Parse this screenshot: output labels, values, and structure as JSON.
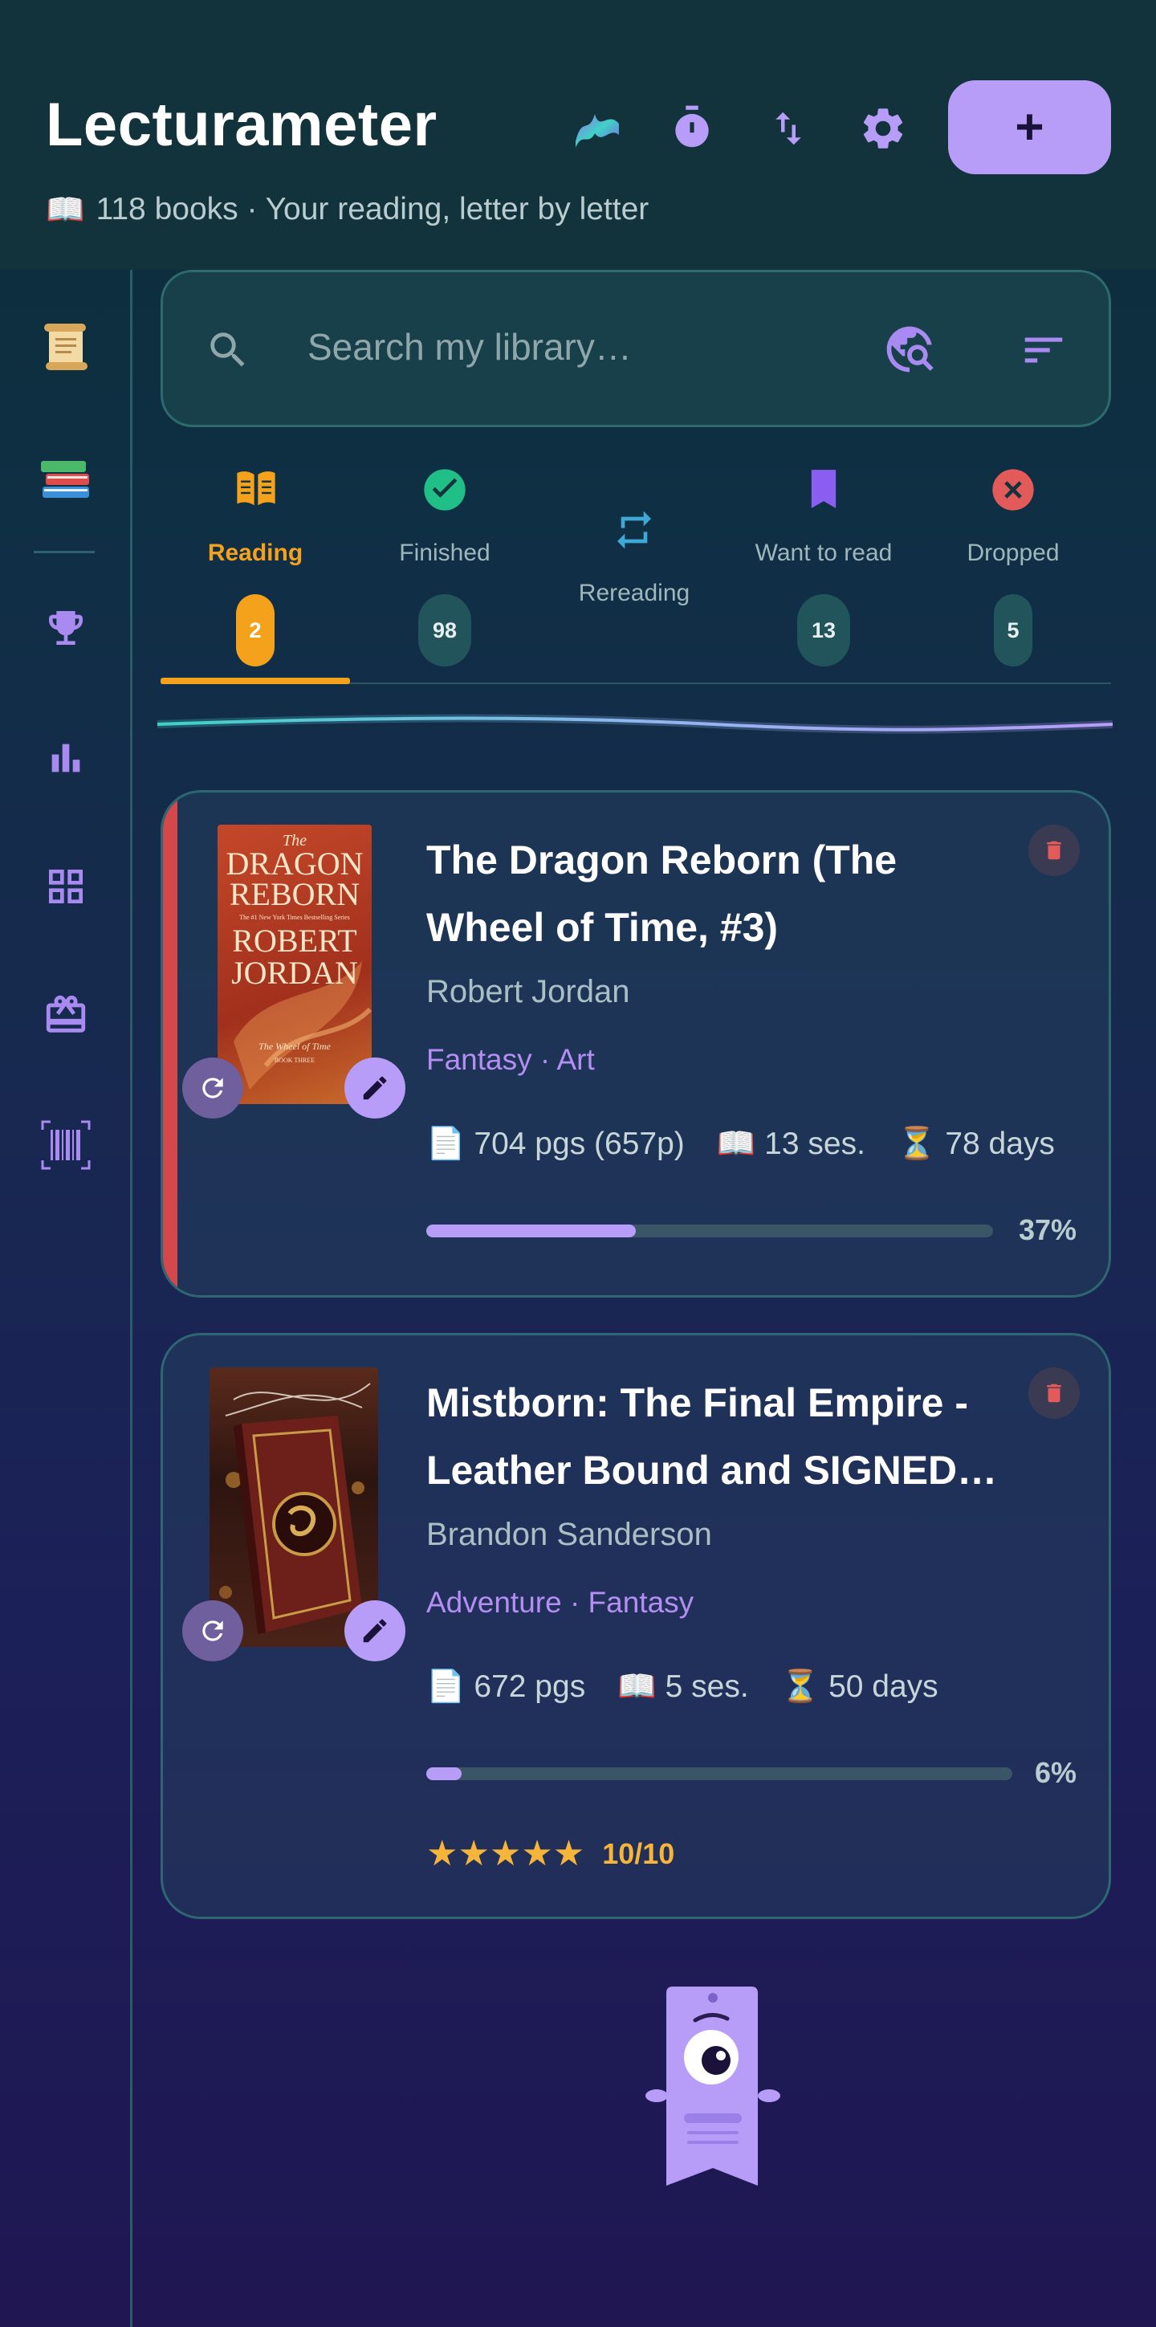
{
  "app": {
    "title": "Lecturameter",
    "subtitle_icon": "📖",
    "subtitle": "118 books · Your reading, letter by letter",
    "add_label": "+"
  },
  "header_icons": [
    "aurora-icon",
    "timer-icon",
    "swap-vertical-icon",
    "gear-icon"
  ],
  "sidebar": [
    "scroll-icon",
    "books-icon",
    "trophy-icon",
    "bar-chart-icon",
    "grid-icon",
    "gift-icon",
    "barcode-icon"
  ],
  "search": {
    "placeholder": "Search my library…"
  },
  "tabs": [
    {
      "label": "Reading",
      "count": "2"
    },
    {
      "label": "Finished",
      "count": "98"
    },
    {
      "label": "Rereading",
      "count": ""
    },
    {
      "label": "Want to read",
      "count": "13"
    },
    {
      "label": "Dropped",
      "count": "5"
    }
  ],
  "books": [
    {
      "title": "The Dragon Reborn (The Wheel of Time, #3)",
      "author": "Robert Jordan",
      "genres": "Fantasy · Art",
      "pages": "704 pgs (657p)",
      "sessions": "13 ses.",
      "days": "78 days",
      "progress": 37,
      "progress_label": "37%",
      "cover": {
        "top": "The",
        "line1": "DRAGON",
        "line2": "REBORN",
        "tagline": "The #1 New York Times Bestselling Series",
        "author1": "ROBERT",
        "author2": "JORDAN",
        "series": "The Wheel of Time",
        "book": "BOOK THREE"
      }
    },
    {
      "title": "Mistborn: The Final Empire - Leather Bound and SIGNED…",
      "author": "Brandon Sanderson",
      "genres": "Adventure · Fantasy",
      "pages": "672 pgs",
      "sessions": "5 ses.",
      "days": "50 days",
      "progress": 6,
      "progress_label": "6%",
      "stars": "★★★★★",
      "rating": "10/10"
    }
  ],
  "icons": {
    "pages": "📄",
    "sessions": "📖",
    "days": "⏳"
  },
  "colors": {
    "accent": "#b79cf8",
    "reading": "#f4a11c",
    "finished": "#1fbf87",
    "dropped": "#e25a5a",
    "stripe": "#d4484b"
  }
}
